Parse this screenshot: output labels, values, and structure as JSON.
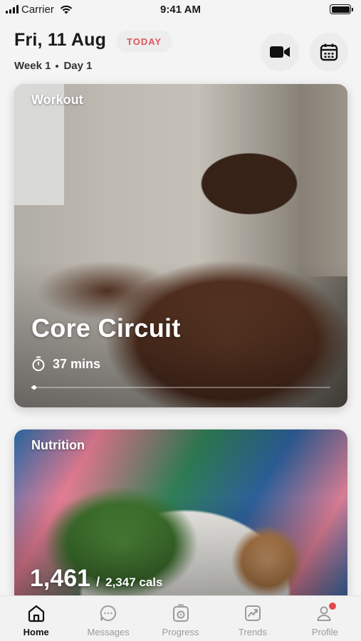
{
  "status_bar": {
    "carrier": "Carrier",
    "time": "9:41 AM"
  },
  "header": {
    "date": "Fri, 11 Aug",
    "today_badge": "TODAY",
    "week": "Week 1",
    "day": "Day 1",
    "video_icon": "video-camera-icon",
    "calendar_icon": "calendar-icon"
  },
  "workout_card": {
    "label": "Workout",
    "title": "Core Circuit",
    "duration": "37 mins",
    "progress": 0.01
  },
  "nutrition_card": {
    "label": "Nutrition",
    "calories_consumed": "1,461",
    "separator": "/",
    "calories_total": "2,347 cals"
  },
  "tab_bar": {
    "items": [
      {
        "label": "Home",
        "icon": "home-icon",
        "active": true
      },
      {
        "label": "Messages",
        "icon": "chat-icon",
        "active": false
      },
      {
        "label": "Progress",
        "icon": "progress-icon",
        "active": false
      },
      {
        "label": "Trends",
        "icon": "trends-icon",
        "active": false
      },
      {
        "label": "Profile",
        "icon": "profile-icon",
        "active": false,
        "badge": true
      }
    ]
  },
  "colors": {
    "accent": "#e0545a",
    "badge": "#e5474b"
  }
}
